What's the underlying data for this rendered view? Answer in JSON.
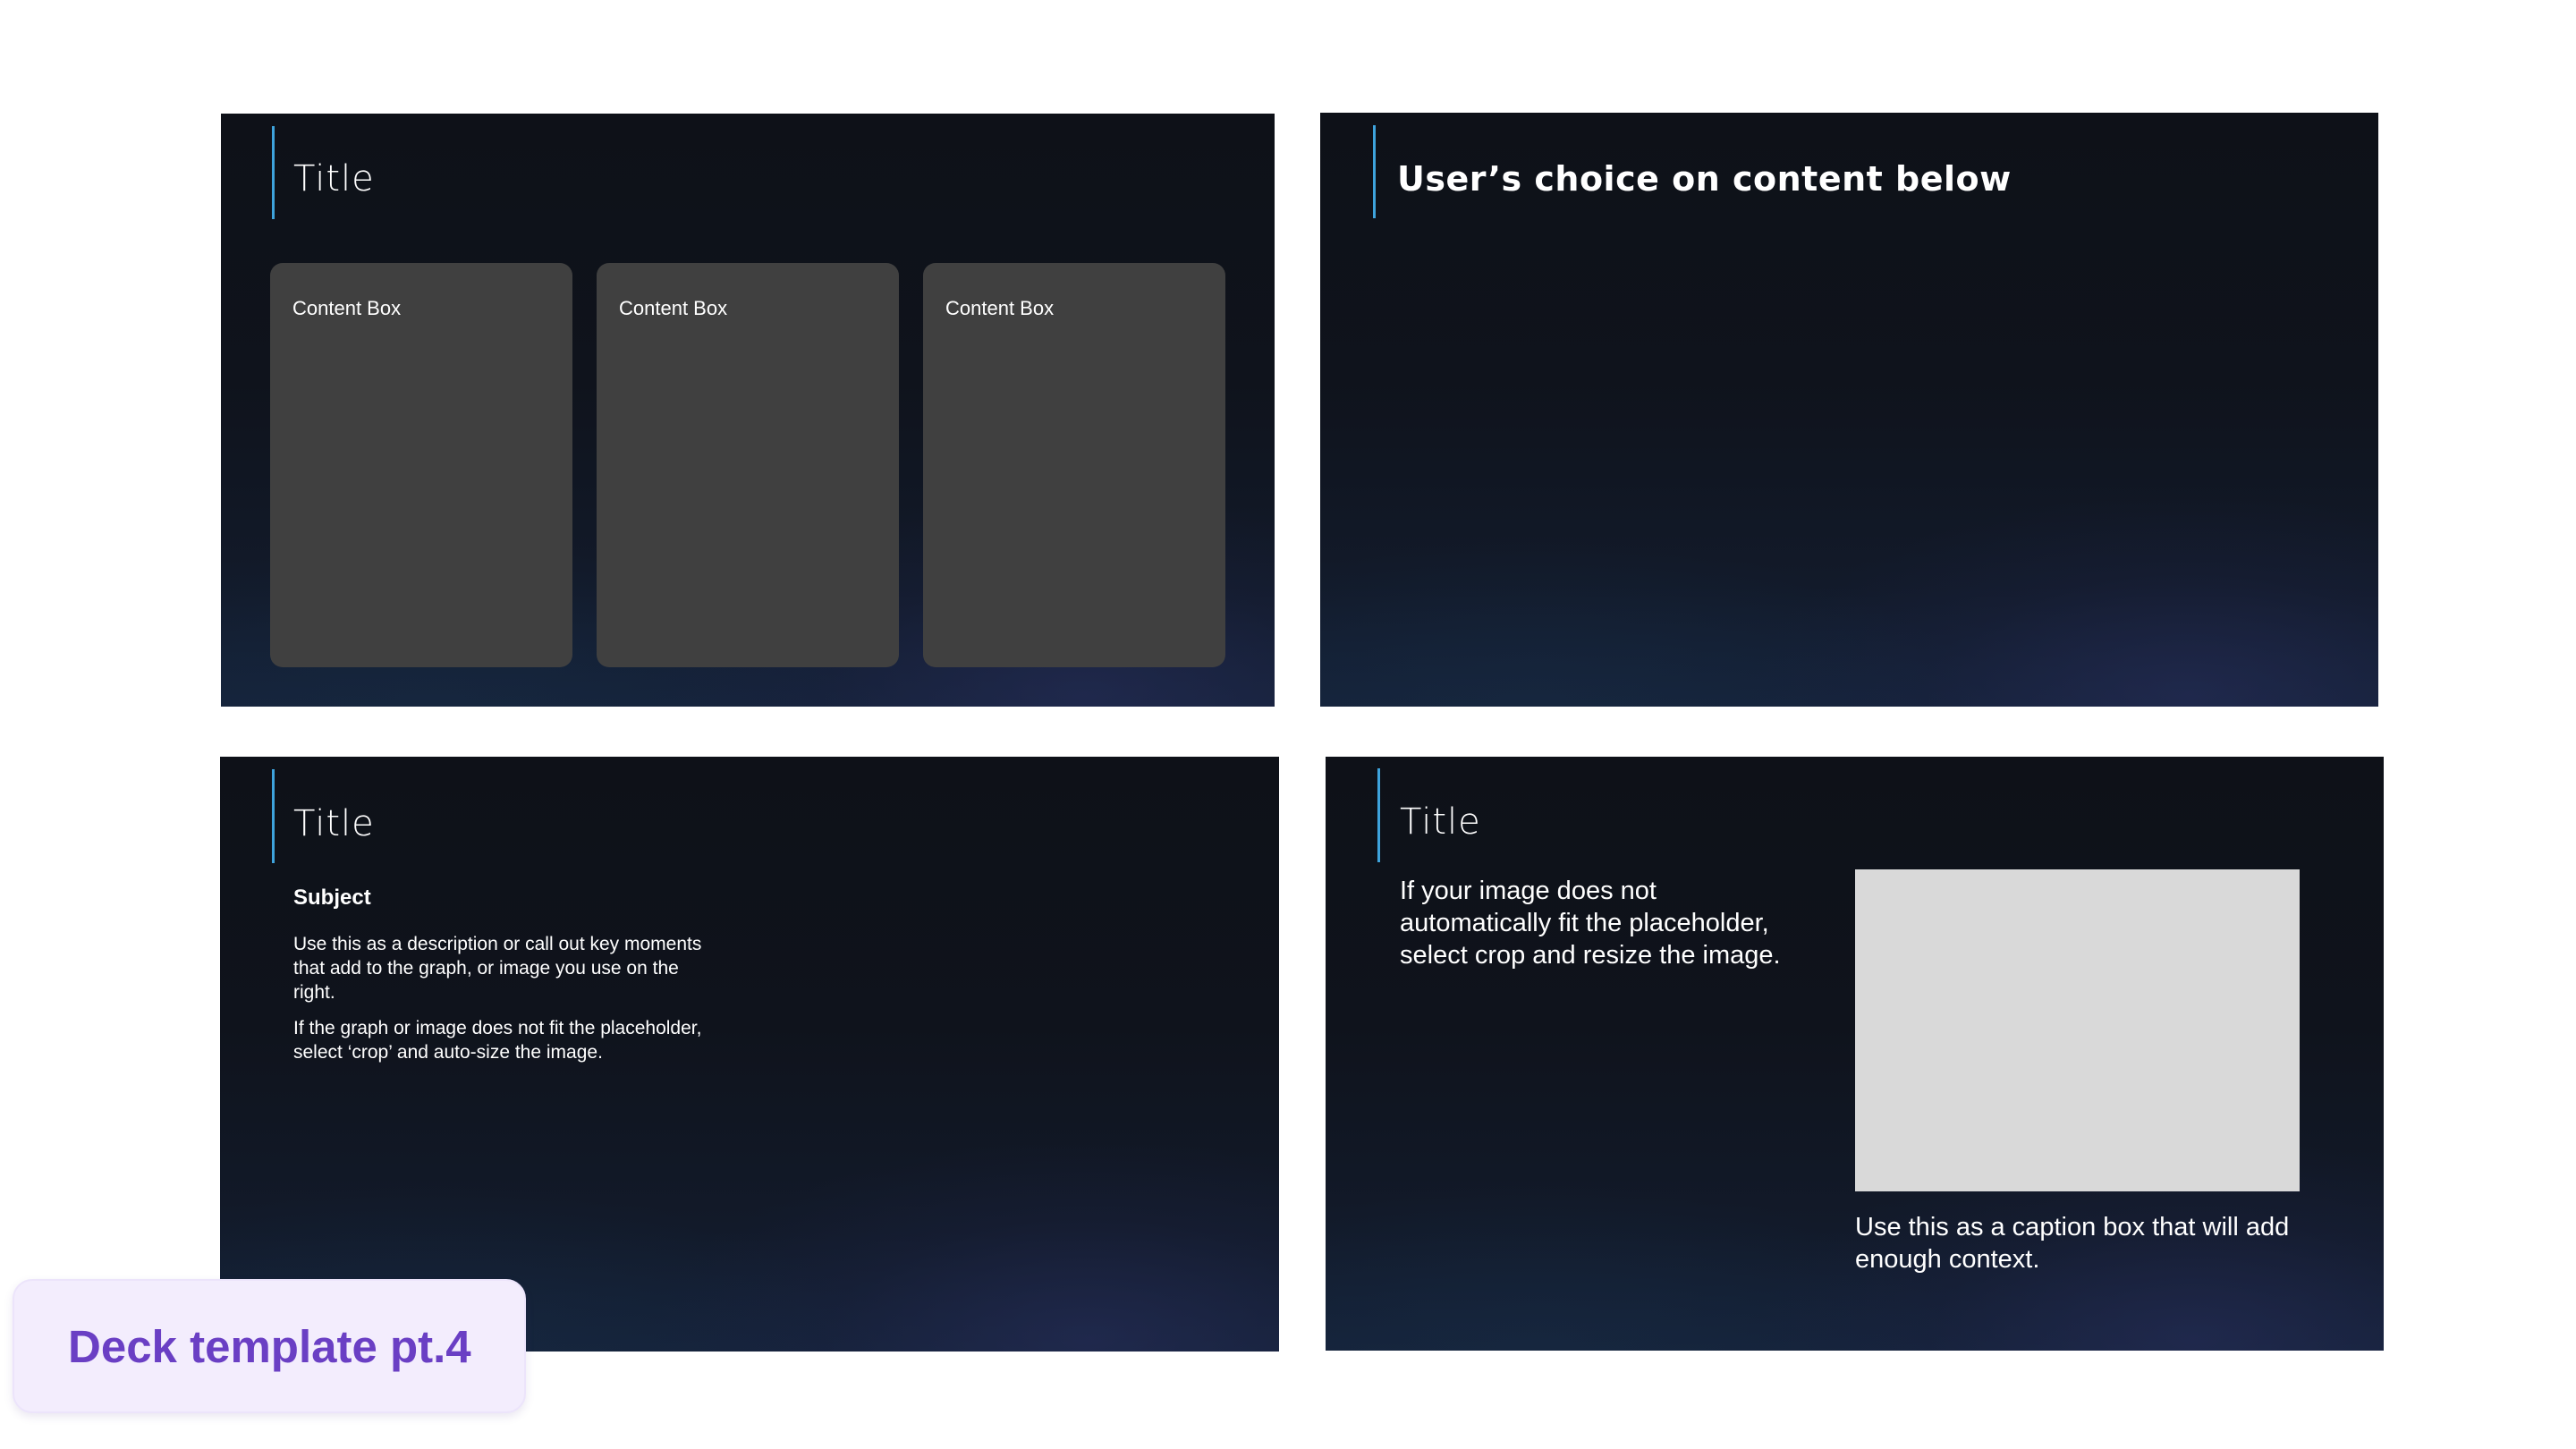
{
  "slides": [
    {
      "title": "Title",
      "content_boxes": [
        "Content Box",
        "Content Box",
        "Content Box"
      ]
    },
    {
      "title": "User’s choice on content below"
    },
    {
      "title": "Title",
      "subject": "Subject",
      "paragraphs": [
        "Use this as a description or call out key moments that add to the graph, or image you use on the right.",
        "If the graph or image does not fit the placeholder, select ‘crop’ and auto-size the image."
      ]
    },
    {
      "title": "Title",
      "body": "If your image does not automatically fit the placeholder, select crop and resize the image.",
      "caption": "Use this as a caption box that will add enough context."
    }
  ],
  "deck_label": "Deck template pt.4",
  "colors": {
    "accent_rule": "#3ea3dc",
    "content_box": "#404040",
    "image_placeholder": "#d9d9d9",
    "label_text": "#6a3fc4",
    "label_bg": "#f3edfd"
  }
}
